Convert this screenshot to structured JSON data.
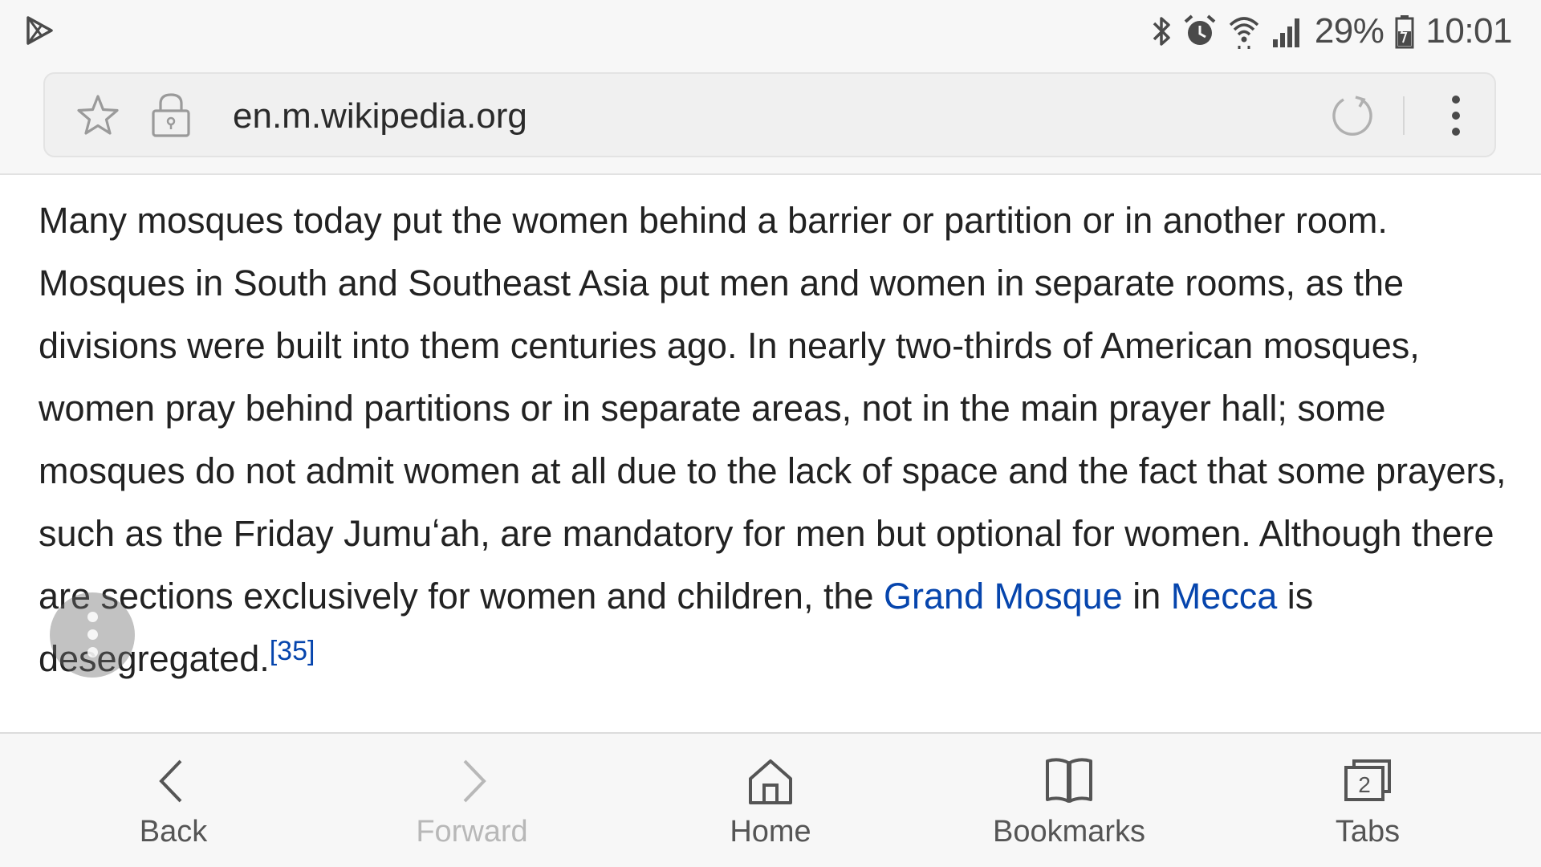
{
  "status_bar": {
    "battery_percent": "29%",
    "time": "10:01",
    "icons": [
      "play-store-icon",
      "bluetooth-icon",
      "alarm-icon",
      "wifi-icon",
      "signal-icon",
      "battery-icon"
    ]
  },
  "address_bar": {
    "url": "en.m.wikipedia.org",
    "icons": [
      "star-icon",
      "lock-icon",
      "reload-icon",
      "more-vert-icon"
    ]
  },
  "article": {
    "text_main": "Many mosques today put the women behind a barrier or partition or in another room. Mosques in South and Southeast Asia put men and women in separate rooms, as the divisions were built into them centuries ago. In nearly two-thirds of American mosques, women pray behind partitions or in separate areas, not in the main prayer hall; some mosques do not admit women at all due to the lack of space and the fact that some prayers, such as the Friday Jumuʻah, are mandatory for men but optional for women. Although there are sections exclusively for women and children, the ",
    "link_grand_mosque": "Grand Mosque",
    "text_in": " in ",
    "link_mecca": "Mecca",
    "text_end": " is desegregated.",
    "citation": "[35]"
  },
  "bottom_nav": {
    "back": "Back",
    "forward": "Forward",
    "home": "Home",
    "bookmarks": "Bookmarks",
    "tabs": "Tabs",
    "tab_count": "2"
  },
  "colors": {
    "link": "#0645ad",
    "bar_background": "#f7f7f7",
    "text": "#222222"
  }
}
